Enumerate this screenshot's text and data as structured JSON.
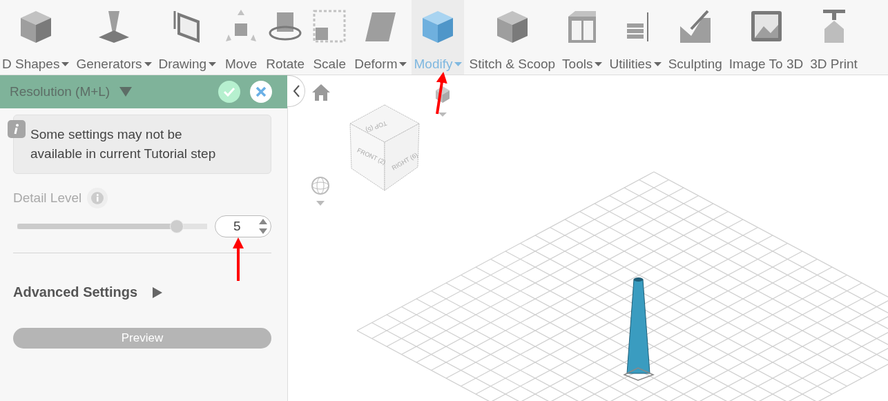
{
  "toolbar": {
    "items": [
      {
        "label": "D Shapes",
        "dropdown": true,
        "selected": false
      },
      {
        "label": "Generators",
        "dropdown": true,
        "selected": false
      },
      {
        "label": "Drawing",
        "dropdown": true,
        "selected": false
      },
      {
        "label": "Move",
        "dropdown": false,
        "selected": false
      },
      {
        "label": "Rotate",
        "dropdown": false,
        "selected": false
      },
      {
        "label": "Scale",
        "dropdown": false,
        "selected": false
      },
      {
        "label": "Deform",
        "dropdown": true,
        "selected": false
      },
      {
        "label": "Modify",
        "dropdown": true,
        "selected": true
      },
      {
        "label": "Stitch & Scoop",
        "dropdown": false,
        "selected": false
      },
      {
        "label": "Tools",
        "dropdown": true,
        "selected": false
      },
      {
        "label": "Utilities",
        "dropdown": true,
        "selected": false
      },
      {
        "label": "Sculpting",
        "dropdown": false,
        "selected": false
      },
      {
        "label": "Image To 3D",
        "dropdown": false,
        "selected": false
      },
      {
        "label": "3D Print",
        "dropdown": false,
        "selected": false
      }
    ]
  },
  "panel": {
    "title": "Resolution (M+L)",
    "notice": "Some settings may not be available in current Tutorial step",
    "detail_level": {
      "label": "Detail Level",
      "disabled": true,
      "level": 0.84,
      "value": "5"
    },
    "advanced": {
      "label": "Advanced Settings",
      "expanded": false
    },
    "preview_button": "Preview"
  },
  "viewport": {
    "view_cube": {
      "top": "TOP (5)",
      "front": "FRONT (2)",
      "right": "RIGHT (6)"
    }
  }
}
